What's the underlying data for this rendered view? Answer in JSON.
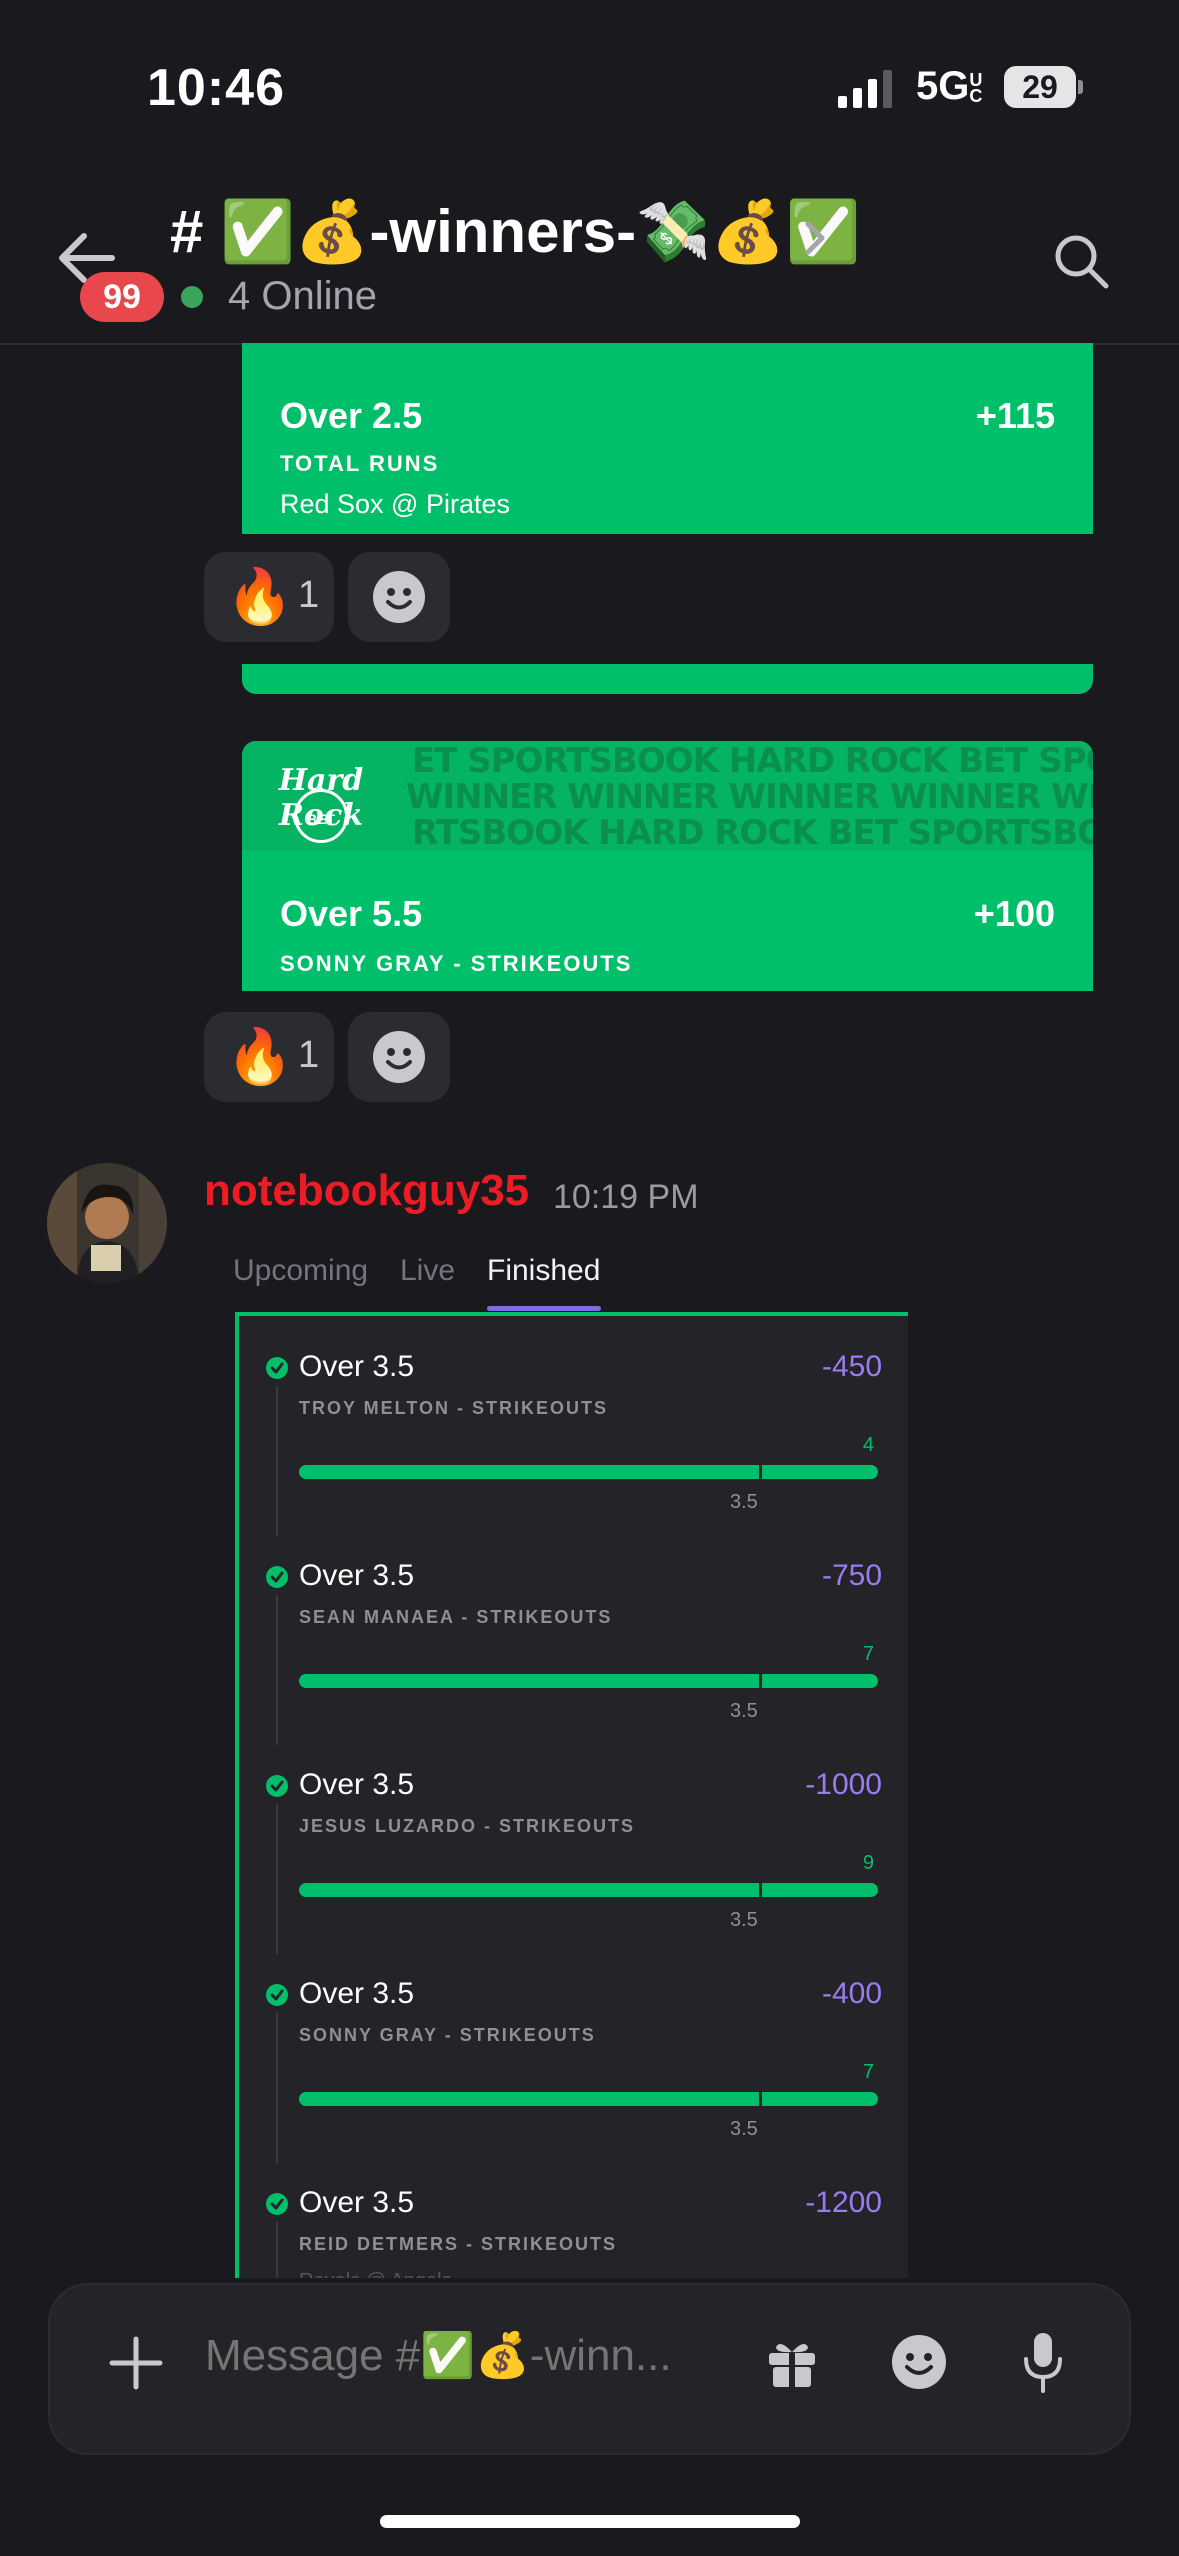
{
  "status_bar": {
    "time": "10:46",
    "network": "5G",
    "network_suffix": "UC",
    "battery": "29"
  },
  "header": {
    "title": "# ✅💰-winners-💸💰✅",
    "unread_badge": "99",
    "online_text": "4 Online"
  },
  "card1": {
    "pick": "Over 2.5",
    "odds": "+115",
    "market": "TOTAL RUNS",
    "game": "Red Sox @ Pirates"
  },
  "card1_reaction": {
    "emoji": "🔥",
    "count": "1"
  },
  "card2": {
    "logo_text": "Hard Rock",
    "logo_sub": "BET",
    "banner_row1": "ET SPORTSBOOK HARD ROCK BET SPORTSBOOK HARD ROCK BE",
    "banner_row2": "WINNER WINNER WINNER WINNER WINNER WINNER WINNER W",
    "banner_row3": "RTSBOOK HARD ROCK BET SPORTSBOOK HARD ROCK BET SP",
    "pick": "Over 5.5",
    "odds": "+100",
    "market": "SONNY GRAY - STRIKEOUTS"
  },
  "card2_reaction": {
    "emoji": "🔥",
    "count": "1"
  },
  "message": {
    "username": "notebookguy35",
    "time": "10:19 PM",
    "tabs": [
      "Upcoming",
      "Live",
      "Finished"
    ],
    "active_tab": "Finished",
    "legs": [
      {
        "pick": "Over 3.5",
        "odds": "-450",
        "market": "TROY MELTON - STRIKEOUTS",
        "actual": "4",
        "line": "3.5",
        "progress": 1.0
      },
      {
        "pick": "Over 3.5",
        "odds": "-750",
        "market": "SEAN MANAEA - STRIKEOUTS",
        "actual": "7",
        "line": "3.5",
        "progress": 1.0
      },
      {
        "pick": "Over 3.5",
        "odds": "-1000",
        "market": "JESUS LUZARDO - STRIKEOUTS",
        "actual": "9",
        "line": "3.5",
        "progress": 1.0
      },
      {
        "pick": "Over 3.5",
        "odds": "-400",
        "market": "SONNY GRAY - STRIKEOUTS",
        "actual": "7",
        "line": "3.5",
        "progress": 1.0
      },
      {
        "pick": "Over 3.5",
        "odds": "-1200",
        "market": "REID DETMERS - STRIKEOUTS",
        "game": "Royals @ Angels"
      }
    ]
  },
  "composer": {
    "placeholder": "Message #✅💰-winn..."
  },
  "icons": [
    "signal-icon",
    "back-arrow-icon",
    "chevron-right-icon",
    "search-icon",
    "smiley-add-icon",
    "check-circle-icon",
    "plus-icon",
    "gift-icon",
    "emoji-icon",
    "mic-icon"
  ],
  "colors": {
    "accent_green": "#00bf6a",
    "odds_purple": "#9b7cf0",
    "username_red": "#ed1c24",
    "badge_red": "#e8484c",
    "online_green": "#3ba55c"
  }
}
